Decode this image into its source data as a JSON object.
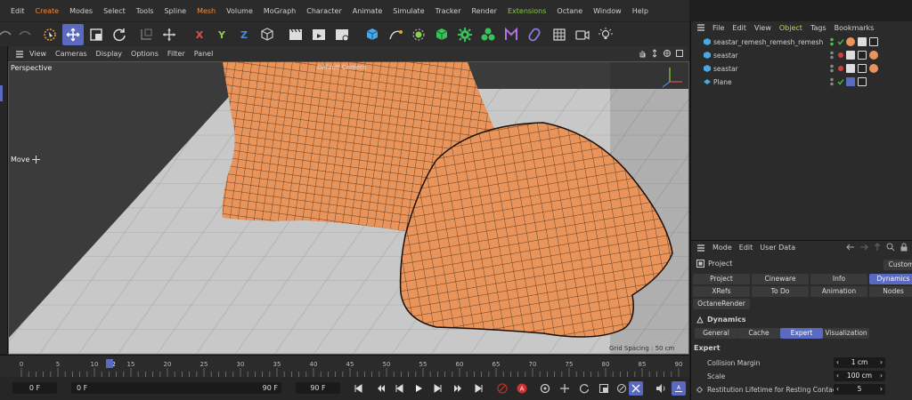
{
  "menu": [
    "Edit",
    "Create",
    "Modes",
    "Select",
    "Tools",
    "Spline",
    "Mesh",
    "Volume",
    "MoGraph",
    "Character",
    "Animate",
    "Simulate",
    "Tracker",
    "Render",
    "Extensions",
    "Octane",
    "Window",
    "Help"
  ],
  "toolbar_axes": [
    "X",
    "Y",
    "Z"
  ],
  "viewport": {
    "menu": [
      "View",
      "Cameras",
      "Display",
      "Options",
      "Filter",
      "Panel"
    ],
    "name": "Perspective",
    "camera": "Default Camera",
    "tool": "Move",
    "grid_spacing": "Grid Spacing : 50 cm"
  },
  "timeline": {
    "ticks": [
      "0",
      "5",
      "10",
      "12",
      "15",
      "20",
      "25",
      "30",
      "35",
      "40",
      "45",
      "50",
      "55",
      "60",
      "65",
      "70",
      "75",
      "80",
      "85",
      "90"
    ],
    "current_frame": "12",
    "start_field": "0 F",
    "min_field": "0 F",
    "max_field": "90 F",
    "end_field": "90 F"
  },
  "object_manager": {
    "menu": [
      "File",
      "Edit",
      "View",
      "Object",
      "Tags",
      "Bookmarks"
    ],
    "objects": [
      {
        "name": "seastar_remesh_remesh_remesh"
      },
      {
        "name": "seastar"
      },
      {
        "name": "seastar"
      },
      {
        "name": "Plane"
      }
    ]
  },
  "attribute_manager": {
    "menu": [
      "Mode",
      "Edit",
      "User Data"
    ],
    "context": "Project",
    "preset": "Custom",
    "tabs_row1": [
      "Project",
      "Cineware",
      "Info",
      "Dynamics"
    ],
    "tabs_row2": [
      "XRefs",
      "To Do",
      "Animation",
      "Nodes"
    ],
    "tabs_row3": [
      "OctaneRender"
    ],
    "section": "Dynamics",
    "subtabs": [
      "General",
      "Cache",
      "Expert",
      "Visualization"
    ],
    "group": "Expert",
    "params": [
      {
        "label": "Collision Margin",
        "value": "1 cm"
      },
      {
        "label": "Scale",
        "value": "100 cm"
      },
      {
        "label": "Restitution Lifetime for Resting Contact",
        "value": "5"
      }
    ]
  },
  "colors": {
    "accent": "#5a6ac0",
    "mesh": "#e8945a",
    "menu_highlight": "#f08a3a"
  }
}
